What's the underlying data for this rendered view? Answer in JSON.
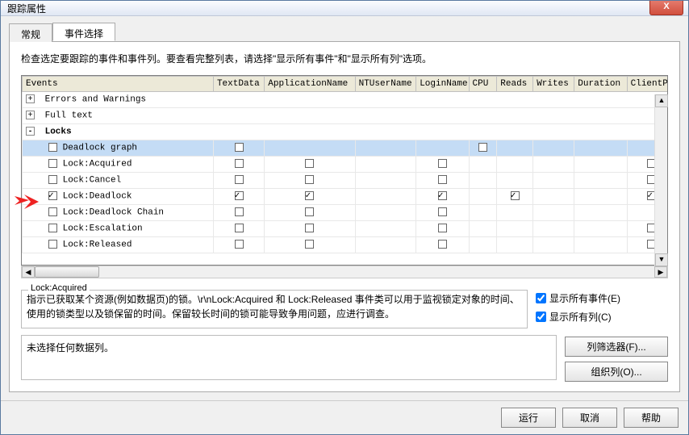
{
  "window": {
    "title": "跟踪属性"
  },
  "tabs": {
    "general": "常规",
    "events": "事件选择"
  },
  "instruction": "检查选定要跟踪的事件和事件列。要查看完整列表，请选择\"显示所有事件\"和\"显示所有列\"选项。",
  "columns": [
    "Events",
    "TextData",
    "ApplicationName",
    "NTUserName",
    "LoginName",
    "CPU",
    "Reads",
    "Writes",
    "Duration",
    "ClientP"
  ],
  "rows": [
    {
      "type": "group",
      "expander": "+",
      "label": "Errors and Warnings",
      "bold": false
    },
    {
      "type": "group",
      "expander": "+",
      "label": "Full text",
      "bold": false
    },
    {
      "type": "group",
      "expander": "-",
      "label": "Locks",
      "bold": true
    },
    {
      "type": "event",
      "checked": false,
      "label": "Deadlock graph",
      "selected": true,
      "cells": [
        false,
        null,
        null,
        null,
        false,
        null,
        null,
        null,
        null
      ]
    },
    {
      "type": "event",
      "checked": false,
      "label": "Lock:Acquired",
      "cells": [
        false,
        false,
        null,
        false,
        null,
        null,
        null,
        null,
        false
      ]
    },
    {
      "type": "event",
      "checked": false,
      "label": "Lock:Cancel",
      "cells": [
        false,
        false,
        null,
        false,
        null,
        null,
        null,
        null,
        false
      ]
    },
    {
      "type": "event",
      "checked": true,
      "label": "Lock:Deadlock",
      "arrow": true,
      "cells": [
        true,
        true,
        null,
        true,
        null,
        true,
        null,
        null,
        true
      ]
    },
    {
      "type": "event",
      "checked": false,
      "label": "Lock:Deadlock Chain",
      "cells": [
        false,
        false,
        null,
        false,
        null,
        null,
        null,
        null,
        null
      ]
    },
    {
      "type": "event",
      "checked": false,
      "label": "Lock:Escalation",
      "cells": [
        false,
        false,
        null,
        false,
        null,
        null,
        null,
        null,
        false
      ]
    },
    {
      "type": "event",
      "checked": false,
      "label": "Lock:Released",
      "cells": [
        false,
        false,
        null,
        false,
        null,
        null,
        null,
        null,
        false
      ]
    }
  ],
  "description": {
    "legend": "Lock:Acquired",
    "text": "指示已获取某个资源(例如数据页)的锁。\\r\\nLock:Acquired 和 Lock:Released 事件类可以用于监视锁定对象的时间、使用的锁类型以及锁保留的时间。保留较长时间的锁可能导致争用问题，应进行调查。"
  },
  "options": {
    "show_all_events": {
      "label": "显示所有事件(E)",
      "checked": true
    },
    "show_all_columns": {
      "label": "显示所有列(C)",
      "checked": true
    }
  },
  "nodata_text": "未选择任何数据列。",
  "side_buttons": {
    "column_filter": "列筛选器(F)...",
    "organize": "组织列(O)..."
  },
  "bottom_buttons": {
    "run": "运行",
    "cancel": "取消",
    "help": "帮助"
  }
}
